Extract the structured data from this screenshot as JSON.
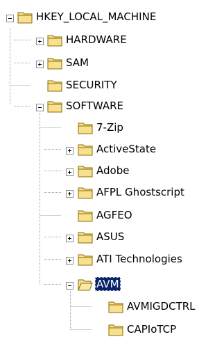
{
  "colors": {
    "selection": "#0a246a",
    "folder_fill": "#f8e08e",
    "folder_stroke": "#8a6d00"
  },
  "tree": [
    {
      "label": "HKEY_LOCAL_MACHINE",
      "toggle": "minus",
      "icon": "folder-icon"
    },
    {
      "label": "HARDWARE",
      "toggle": "plus",
      "icon": "folder-icon"
    },
    {
      "label": "SAM",
      "toggle": "plus",
      "icon": "folder-icon"
    },
    {
      "label": "SECURITY",
      "toggle": "none",
      "icon": "folder-icon"
    },
    {
      "label": "SOFTWARE",
      "toggle": "minus",
      "icon": "folder-icon"
    },
    {
      "label": "7-Zip",
      "toggle": "none",
      "icon": "folder-icon"
    },
    {
      "label": "ActiveState",
      "toggle": "plus",
      "icon": "folder-icon"
    },
    {
      "label": "Adobe",
      "toggle": "plus",
      "icon": "folder-icon"
    },
    {
      "label": "AFPL Ghostscript",
      "toggle": "plus",
      "icon": "folder-icon"
    },
    {
      "label": "AGFEO",
      "toggle": "none",
      "icon": "folder-icon"
    },
    {
      "label": "ASUS",
      "toggle": "plus",
      "icon": "folder-icon"
    },
    {
      "label": "ATI Technologies",
      "toggle": "plus",
      "icon": "folder-icon"
    },
    {
      "label": "AVM",
      "toggle": "minus",
      "icon": "folder-open-icon",
      "selected": true
    },
    {
      "label": "AVMIGDCTRL",
      "toggle": "none",
      "icon": "folder-icon"
    },
    {
      "label": "CAPIoTCP",
      "toggle": "none",
      "icon": "folder-icon"
    }
  ]
}
